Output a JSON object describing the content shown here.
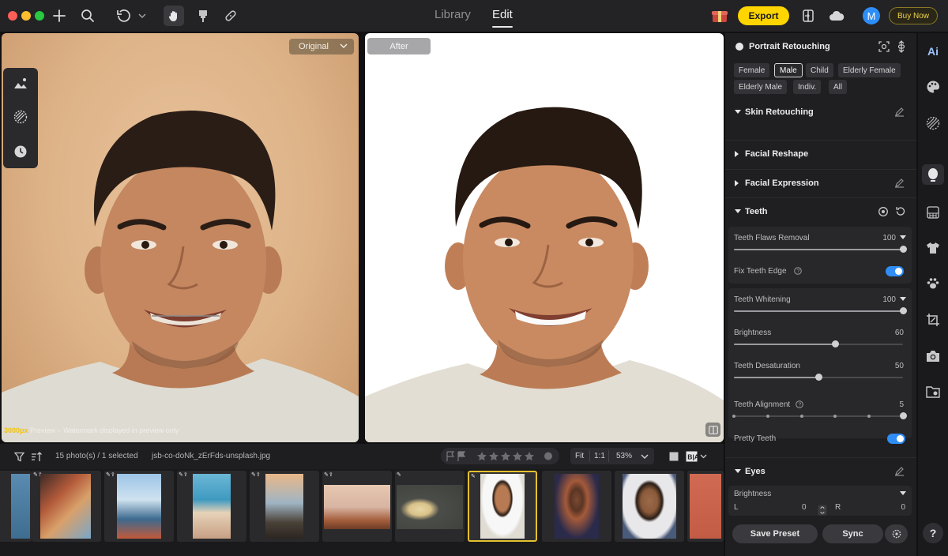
{
  "toolbar": {
    "tabs": [
      {
        "label": "Library",
        "active": false
      },
      {
        "label": "Edit",
        "active": true
      }
    ],
    "export_label": "Export",
    "avatar_initial": "M",
    "buy_now_label": "Buy Now",
    "icons": [
      "add-icon",
      "search-icon",
      "undo-icon",
      "hand-icon",
      "brush-icon",
      "bandage-icon",
      "gift-icon",
      "compare-icon",
      "cloud-icon"
    ]
  },
  "canvas": {
    "original_label": "Original",
    "after_label": "After",
    "watermark": {
      "size": "3000px",
      "text": "Preview – Watermark displayed in preview only"
    },
    "left_tools": [
      "landscape-icon",
      "mask-icon",
      "history-icon"
    ]
  },
  "filmstrip": {
    "count_text": "15 photo(s) / 1 selected",
    "filename": "jsb-co-doNk_zErFds-unsplash.jpg",
    "rating_stars": 5,
    "fit_label": "Fit",
    "one_to_one_label": "1:1",
    "zoom": "53%",
    "compare_label": "B|A",
    "thumbs": [
      {
        "name": "alley",
        "selected": false
      },
      {
        "name": "city-skyline",
        "selected": false
      },
      {
        "name": "beach",
        "selected": false
      },
      {
        "name": "rock-cliff",
        "selected": false
      },
      {
        "name": "balloons",
        "selected": false
      },
      {
        "name": "blonde-woman",
        "selected": false
      },
      {
        "name": "young-man",
        "selected": true
      },
      {
        "name": "man-hat",
        "selected": false
      },
      {
        "name": "bearded-man",
        "selected": false
      },
      {
        "name": "coral-wall",
        "selected": false
      }
    ]
  },
  "panel": {
    "title": "Portrait Retouching",
    "chips": [
      "Female",
      "Male",
      "Child",
      "Elderly Female",
      "Elderly Male",
      "Indiv.",
      "All"
    ],
    "selected_chip": "Male",
    "sections": {
      "skin": "Skin Retouching",
      "reshape": "Facial Reshape",
      "expression": "Facial Expression",
      "teeth": "Teeth",
      "eyes": "Eyes"
    },
    "teeth": {
      "flaws_label": "Teeth Flaws Removal",
      "flaws_value": "100",
      "flaws_level": 1.0,
      "fix_edge_label": "Fix Teeth Edge",
      "fix_edge_on": true,
      "whitening_label": "Teeth Whitening",
      "whitening_value": "100",
      "whitening_level": 1.0,
      "brightness_label": "Brightness",
      "brightness_value": "60",
      "brightness_level": 0.6,
      "desaturation_label": "Teeth Desaturation",
      "desaturation_value": "50",
      "desaturation_level": 0.5,
      "alignment_label": "Teeth Alignment",
      "alignment_value": "5",
      "alignment_level": 1.0,
      "pretty_label": "Pretty Teeth",
      "pretty_on": true
    },
    "eyes": {
      "brightness_label": "Brightness",
      "left_label": "L",
      "left_value": "0",
      "right_label": "R",
      "right_value": "0"
    },
    "save_preset_label": "Save Preset",
    "sync_label": "Sync"
  },
  "rail": {
    "ai_label": "Ai",
    "icons": [
      "palette-icon",
      "texture-icon",
      "face-icon",
      "grid-icon",
      "shirt-icon",
      "paw-icon",
      "crop-icon",
      "camera-icon",
      "folder-icon"
    ],
    "help_label": "?"
  },
  "colors": {
    "accent": "#ffd500",
    "toggle": "#2f8df5",
    "selection": "#e3c12e"
  }
}
